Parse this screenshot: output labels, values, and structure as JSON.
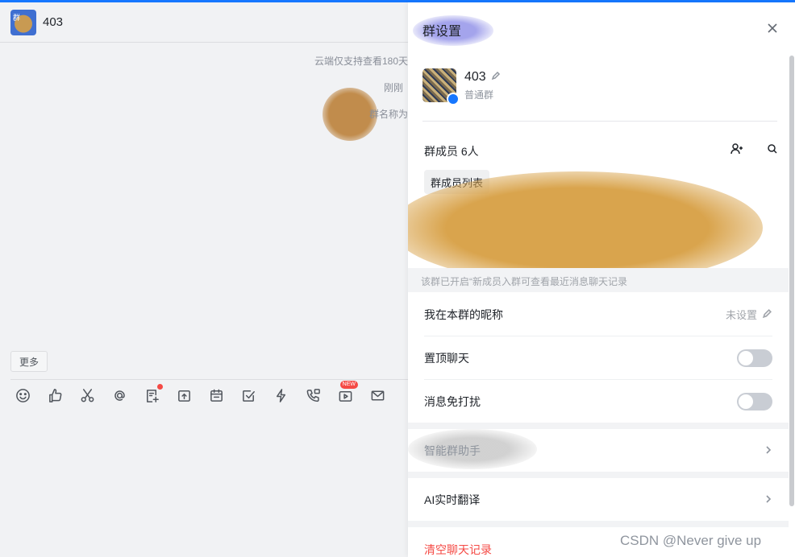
{
  "chat": {
    "title": "403",
    "avatar_text": "群",
    "system_messages": [
      "云端仅支持查看180天",
      "刚刚",
      "群名称为"
    ],
    "more_label": "更多",
    "toolbar": [
      {
        "icon": "emoji-icon"
      },
      {
        "icon": "thumbs-up-icon"
      },
      {
        "icon": "scissors-icon"
      },
      {
        "icon": "at-icon"
      },
      {
        "icon": "note-add-icon",
        "badge_dot": true
      },
      {
        "icon": "upload-folder-icon"
      },
      {
        "icon": "calendar-icon"
      },
      {
        "icon": "task-check-icon"
      },
      {
        "icon": "lightning-icon"
      },
      {
        "icon": "phone-call-icon"
      },
      {
        "icon": "live-tv-icon",
        "badge_text": "NEW"
      },
      {
        "icon": "mail-icon"
      }
    ]
  },
  "settings": {
    "title": "群设置",
    "group": {
      "name": "403",
      "type": "普通群"
    },
    "members": {
      "label": "群成员 6人",
      "list_button": "群成员列表"
    },
    "info_text": "该群已开启“新成员入群可查看最近消息聊天记录",
    "rows": {
      "nickname": {
        "label": "我在本群的昵称",
        "value": "未设置"
      },
      "pin": {
        "label": "置顶聊天"
      },
      "mute": {
        "label": "消息免打扰"
      },
      "assistant": {
        "label": "智能群助手"
      },
      "translate": {
        "label": "AI实时翻译"
      }
    },
    "clear_history": "清空聊天记录"
  },
  "watermark": "CSDN @Never  give  up",
  "colors": {
    "accent": "#1677ff",
    "danger": "#f54a45",
    "toggle_off": "#c9cdd4"
  }
}
